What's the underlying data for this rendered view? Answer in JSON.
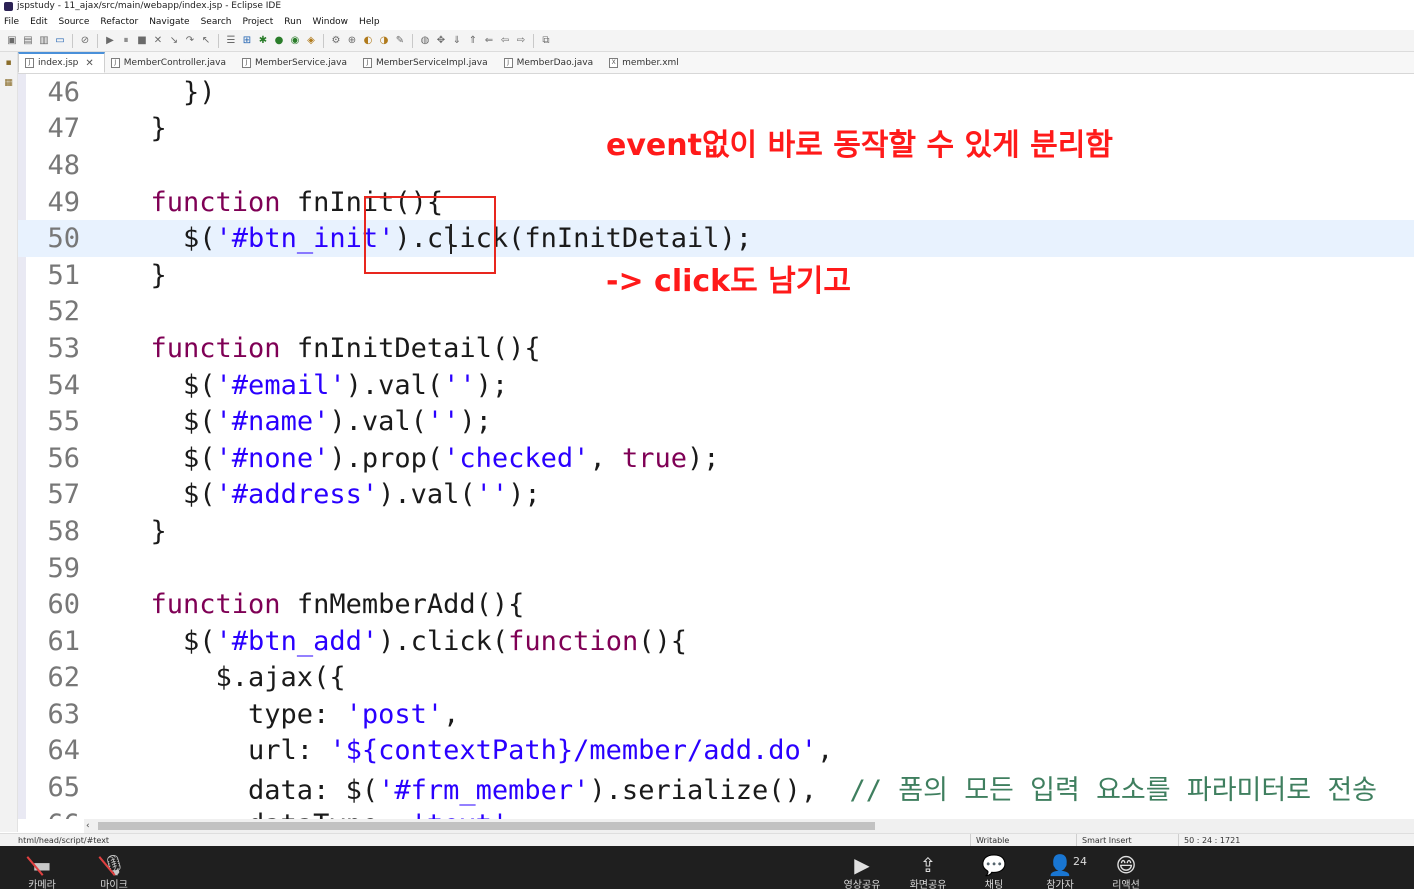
{
  "window": {
    "title": "jspstudy - 11_ajax/src/main/webapp/index.jsp - Eclipse IDE"
  },
  "menu": [
    "File",
    "Edit",
    "Source",
    "Refactor",
    "Navigate",
    "Search",
    "Project",
    "Run",
    "Window",
    "Help"
  ],
  "tabs": [
    {
      "label": "index.jsp",
      "icon": "jsp-file-icon",
      "active": true
    },
    {
      "label": "MemberController.java",
      "icon": "java-file-icon"
    },
    {
      "label": "MemberService.java",
      "icon": "java-file-icon"
    },
    {
      "label": "MemberServiceImpl.java",
      "icon": "java-file-icon"
    },
    {
      "label": "MemberDao.java",
      "icon": "java-file-icon"
    },
    {
      "label": "member.xml",
      "icon": "xml-file-icon"
    }
  ],
  "editor": {
    "current_line": "50",
    "lines": [
      {
        "n": "46",
        "text": "    })"
      },
      {
        "n": "47",
        "text": "  }"
      },
      {
        "n": "48",
        "text": ""
      },
      {
        "n": "49",
        "text": "  function fnInit(){"
      },
      {
        "n": "50",
        "text": "    $('#btn_init').click(fnInitDetail);"
      },
      {
        "n": "51",
        "text": "  }"
      },
      {
        "n": "52",
        "text": ""
      },
      {
        "n": "53",
        "text": "  function fnInitDetail(){"
      },
      {
        "n": "54",
        "text": "    $('#email').val('');"
      },
      {
        "n": "55",
        "text": "    $('#name').val('');"
      },
      {
        "n": "56",
        "text": "    $('#none').prop('checked', true);"
      },
      {
        "n": "57",
        "text": "    $('#address').val('');"
      },
      {
        "n": "58",
        "text": "  }"
      },
      {
        "n": "59",
        "text": ""
      },
      {
        "n": "60",
        "text": "  function fnMemberAdd(){"
      },
      {
        "n": "61",
        "text": "    $('#btn_add').click(function(){"
      },
      {
        "n": "62",
        "text": "      $.ajax({"
      },
      {
        "n": "63",
        "text": "        type: 'post',"
      },
      {
        "n": "64",
        "text": "        url: '${contextPath}/member/add.do',"
      },
      {
        "n": "65",
        "text": "        data: $('#frm_member').serialize(),  // 폼의 모든 입력 요소를 파라미터로 전송"
      },
      {
        "n": "66",
        "text": "        dataType: 'text'"
      }
    ]
  },
  "annotations": {
    "note1": "event없이 바로 동작할 수 있게 분리함",
    "note2": "-> click도 남기고",
    "color": "#ff1a1a"
  },
  "status": {
    "path": "html/head/script/#text",
    "writable": "Writable",
    "insert_mode": "Smart Insert",
    "position": "50 : 24 : 1721"
  },
  "meeting": {
    "buttons": [
      {
        "label": "카메라",
        "icon": "camera-off-icon"
      },
      {
        "label": "마이크",
        "icon": "mic-off-icon"
      },
      {
        "label": "영상공유",
        "icon": "video-share-icon"
      },
      {
        "label": "화면공유",
        "icon": "screen-share-icon"
      },
      {
        "label": "채팅",
        "icon": "chat-icon"
      },
      {
        "label": "참가자",
        "icon": "participants-icon"
      },
      {
        "label": "리액션",
        "icon": "reaction-icon"
      }
    ],
    "participant_count": "24"
  }
}
